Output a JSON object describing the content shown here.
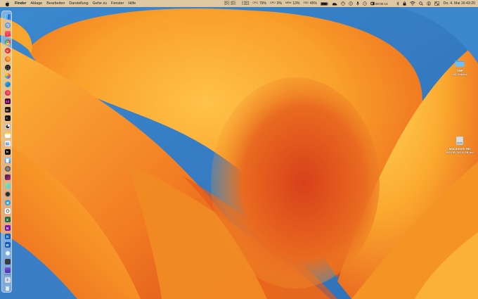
{
  "menubar": {
    "apple_icon": "apple-logo-icon",
    "app_name": "Finder",
    "menus": [
      "Ablage",
      "Bearbeiten",
      "Darstellung",
      "Gehe zu",
      "Fenster",
      "Hilfe"
    ],
    "temps": {
      "top": "36℃ 45℃",
      "bottom": "32℃ 45℃"
    },
    "network": {
      "up": "0 KB/s",
      "down": "3 KB/s"
    },
    "cpu": {
      "label": "CPU",
      "value": "79%"
    },
    "gpu": {
      "label": "GPU",
      "value": "0%"
    },
    "mem": {
      "label": "MEM",
      "value": "13%"
    },
    "disk": {
      "label": "SSD",
      "value": "45%"
    },
    "timer": "00:00:14",
    "clock": "Do. 4. Mai 16:43:20"
  },
  "desktop": {
    "items": [
      {
        "name": "TMP",
        "info": "116 Objekte",
        "icon": "folder-icon"
      },
      {
        "name": "Macintosh HD",
        "info": "500 GB, 162,8 GB frei",
        "icon": "hard-drive-icon"
      }
    ]
  },
  "dock": {
    "apps": [
      "finder",
      "safari",
      "music",
      "chrome",
      "vivaldi",
      "firefox",
      "launchpad",
      "photos",
      "edge",
      "firefox-dev",
      "adobe-xd",
      "bridge",
      "terminal",
      "textedit",
      "cursor",
      "notes",
      "preview",
      "apple-tv",
      "simulator",
      "settings",
      "affinity",
      "maps",
      "calculator",
      "telegram",
      "chatgpt",
      "excel",
      "onenote",
      "outlook",
      "word",
      "xcode",
      "utility",
      "github",
      "tool",
      "adobe",
      "downloads",
      "trash"
    ],
    "colors": {
      "finder": "#2f8af5",
      "safari": "#3a8ee6",
      "music": "#fa3c55",
      "chrome": "#e8453c",
      "vivaldi": "#d83a3a",
      "firefox": "#f57c1f",
      "launchpad": "#8e8ea3",
      "photos": "#f2b64c"
    }
  },
  "colors": {
    "menubar_bg": "#eccea0",
    "accent": "#f39a22"
  }
}
